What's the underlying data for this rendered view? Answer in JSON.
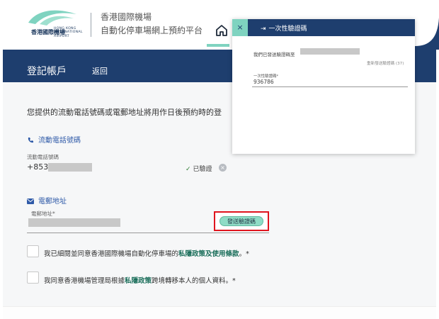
{
  "header": {
    "logo_zh": "香港國際機場",
    "logo_en": "HONG KONG INTERNATIONAL AIRPORT",
    "title_line1": "香港國際機場",
    "title_line2": "自動化停車場網上預約平台",
    "icons": {
      "home": "home-icon"
    }
  },
  "title_bar": {
    "title": "登記帳戶",
    "back_label": "返回"
  },
  "form": {
    "intro": "您提供的流動電話號碼或電郵地址將用作日後預約時的登",
    "phone": {
      "section_title": "流動電話號碼",
      "field_label": "流動電話號碼",
      "prefix": "+853",
      "verified_label": "已驗證",
      "icon": "phone-icon"
    },
    "email": {
      "section_title": "電郵地址",
      "field_label": "電郵地址*",
      "send_button": "發送驗證碼",
      "icon": "mail-icon"
    },
    "agreement1": {
      "before": "我已細閱並同意香港國際機場自動化停車場的",
      "link1": "私隱政策",
      "mid": "及",
      "link2": "使用條款",
      "after": "。*"
    },
    "agreement2": {
      "before": "我同意香港機場管理局根據",
      "link": "私隱政策",
      "after": "跨境轉移本人的個人資料。*"
    }
  },
  "modal": {
    "title": "一次性驗證碼",
    "close_label": "×",
    "sent_text": "我們已發送驗證碼至",
    "resend_text": "重新發送驗證碼 (37)",
    "otp_label": "一次性驗證碼*",
    "otp_value": "936786"
  },
  "colors": {
    "navy": "#1e3e6e",
    "mint": "#8fdcc6",
    "highlight": "#e0141e",
    "link_green": "#1a6e5a",
    "section_blue": "#2f5aa8"
  }
}
